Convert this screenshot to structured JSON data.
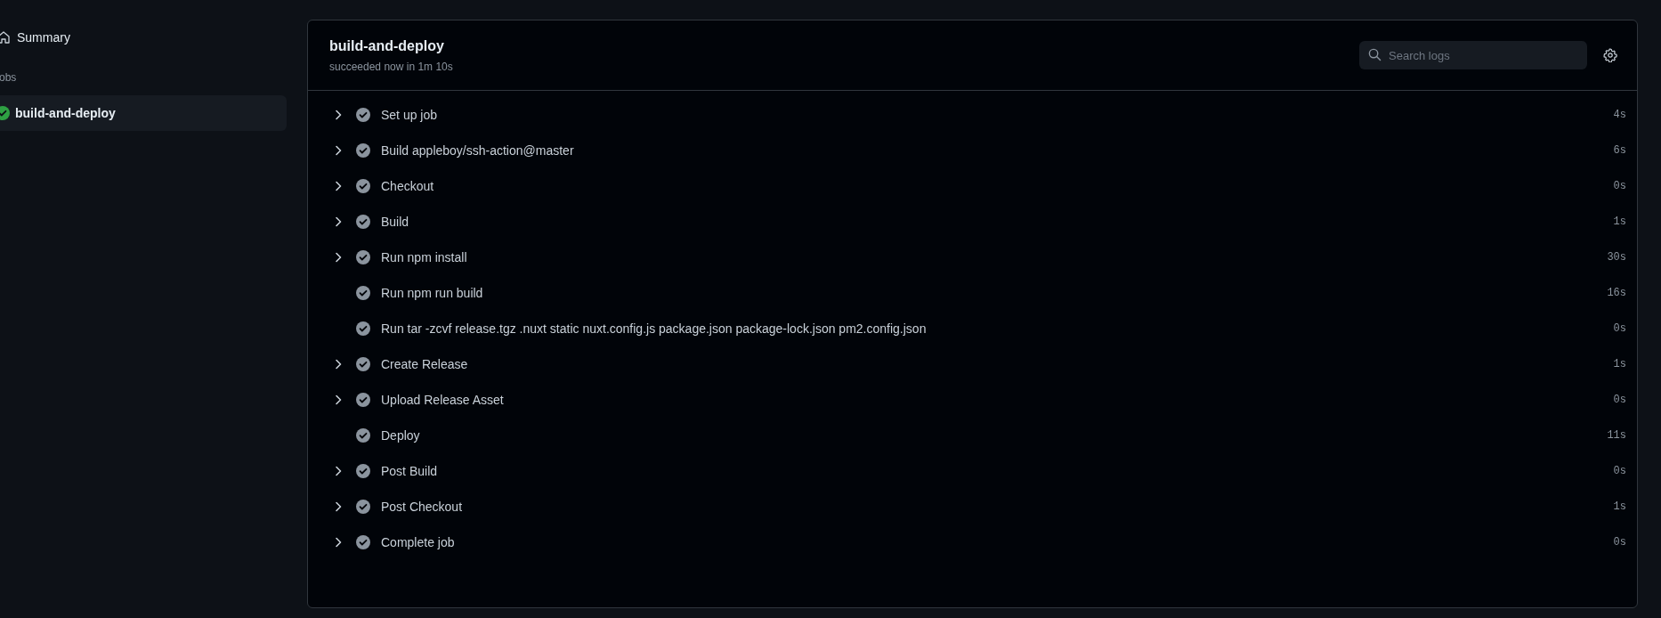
{
  "sidebar": {
    "summary": "Summary",
    "section_label": "obs",
    "jobs": [
      {
        "name": "build-and-deploy",
        "kind": "success",
        "selected": true
      }
    ]
  },
  "job": {
    "title": "build-and-deploy",
    "subtitle": "succeeded now in 1m 10s",
    "search": {
      "placeholder": "Search logs"
    },
    "steps": [
      {
        "name": "Set up job",
        "expandable": true,
        "duration": "4s"
      },
      {
        "name": "Build appleboy/ssh-action@master",
        "expandable": true,
        "duration": "6s"
      },
      {
        "name": "Checkout",
        "expandable": true,
        "duration": "0s"
      },
      {
        "name": "Build",
        "expandable": true,
        "duration": "1s"
      },
      {
        "name": "Run npm install",
        "expandable": true,
        "duration": "30s"
      },
      {
        "name": "Run npm run build",
        "expandable": false,
        "duration": "16s"
      },
      {
        "name": "Run tar -zcvf release.tgz .nuxt static nuxt.config.js package.json package-lock.json pm2.config.json",
        "expandable": false,
        "duration": "0s"
      },
      {
        "name": "Create Release",
        "expandable": true,
        "duration": "1s"
      },
      {
        "name": "Upload Release Asset",
        "expandable": true,
        "duration": "0s"
      },
      {
        "name": "Deploy",
        "expandable": false,
        "duration": "11s"
      },
      {
        "name": "Post Build",
        "expandable": true,
        "duration": "0s"
      },
      {
        "name": "Post Checkout",
        "expandable": true,
        "duration": "1s"
      },
      {
        "name": "Complete job",
        "expandable": true,
        "duration": "0s"
      }
    ]
  }
}
